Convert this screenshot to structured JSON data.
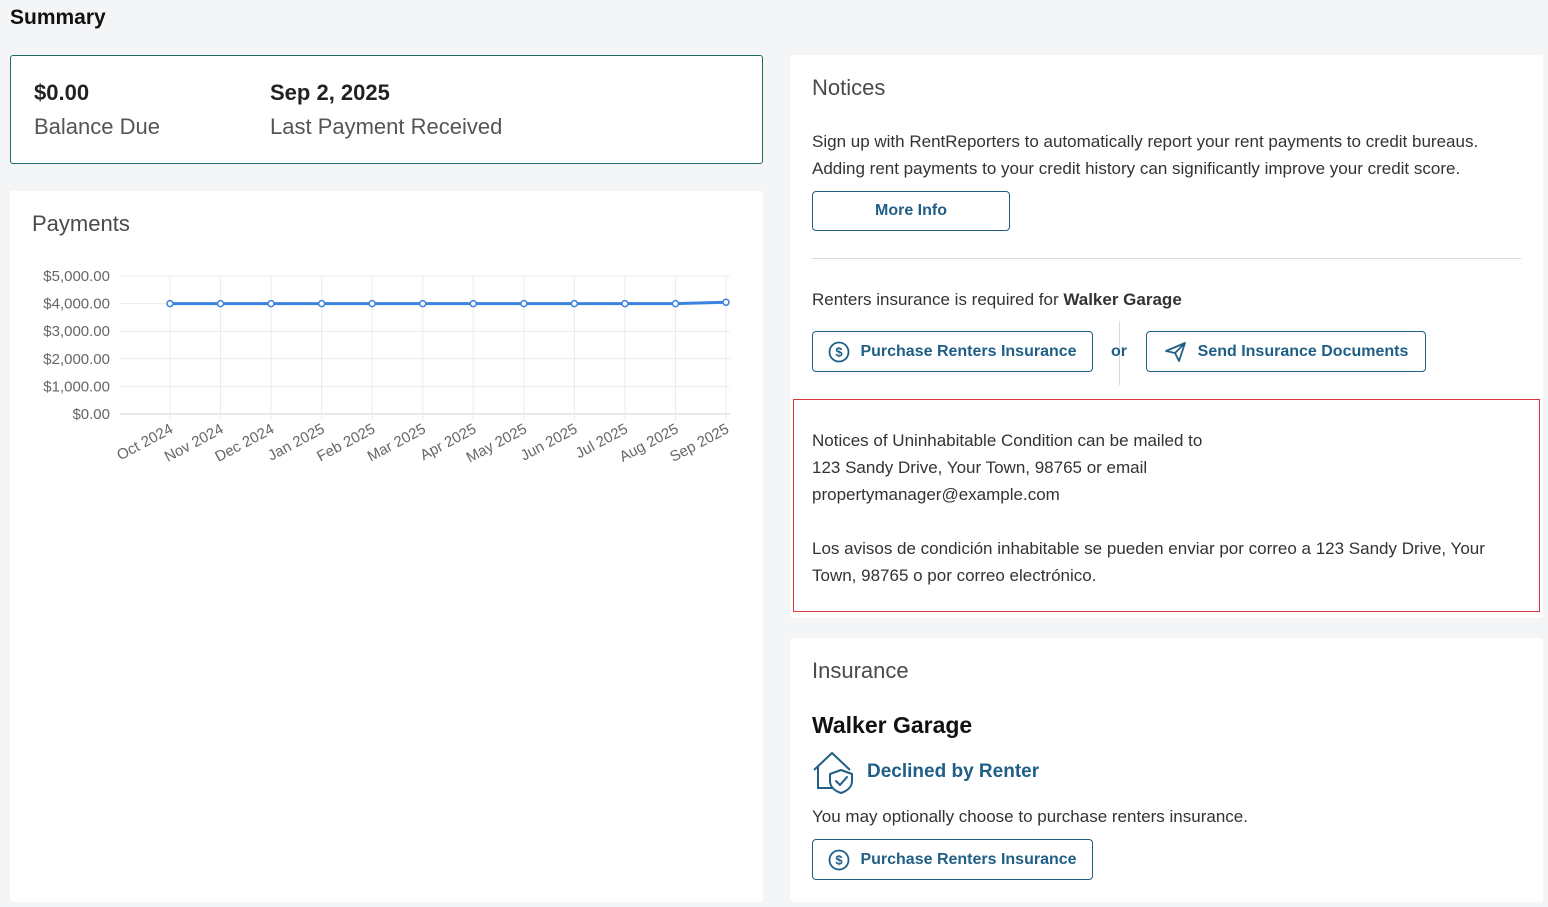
{
  "page": {
    "title": "Summary"
  },
  "summary": {
    "balance_value": "$0.00",
    "balance_label": "Balance Due",
    "last_payment_value": "Sep 2, 2025",
    "last_payment_label": "Last Payment Received"
  },
  "payments": {
    "heading": "Payments"
  },
  "chart_data": {
    "type": "line",
    "categories": [
      "Oct 2024",
      "Nov 2024",
      "Dec 2024",
      "Jan 2025",
      "Feb 2025",
      "Mar 2025",
      "Apr 2025",
      "May 2025",
      "Jun 2025",
      "Jul 2025",
      "Aug 2025",
      "Sep 2025"
    ],
    "values": [
      4000,
      4000,
      4000,
      4000,
      4000,
      4000,
      4000,
      4000,
      4000,
      4000,
      4000,
      4050
    ],
    "y_ticks": [
      "$0.00",
      "$1,000.00",
      "$2,000.00",
      "$3,000.00",
      "$4,000.00",
      "$5,000.00"
    ],
    "ylim": [
      0,
      5000
    ],
    "title": "",
    "xlabel": "",
    "ylabel": "",
    "grid": true,
    "line_color": "#3b82e0"
  },
  "notices": {
    "heading": "Notices",
    "rentreporters_line1": "Sign up with RentReporters to automatically report your rent payments to credit bureaus.",
    "rentreporters_line2": "Adding rent payments to your credit history can significantly improve your credit score.",
    "more_info_label": "More Info",
    "insurance_required_prefix": "Renters insurance is required for ",
    "insurance_required_property": "Walker Garage",
    "purchase_label": "Purchase Renters Insurance",
    "or_label": "or",
    "send_docs_label": "Send Insurance Documents",
    "uninhabitable_en_line1": "Notices of Uninhabitable Condition can be mailed to",
    "uninhabitable_en_line2": "123 Sandy Drive, Your Town, 98765 or email",
    "uninhabitable_en_line3": "propertymanager@example.com",
    "uninhabitable_es_line1": "Los avisos de condición inhabitable se pueden enviar por correo a 123 Sandy Drive, Your",
    "uninhabitable_es_line2": "Town, 98765 o por correo electrónico."
  },
  "insurance": {
    "heading": "Insurance",
    "property_name": "Walker Garage",
    "status": "Declined by Renter",
    "note": "You may optionally choose to purchase renters insurance.",
    "purchase_label": "Purchase Renters Insurance"
  },
  "colors": {
    "accent": "#1f5f86",
    "summary_border": "#1f6b63",
    "alert_border": "#d9363e"
  },
  "icons": {
    "purchase": "dollar-circle-icon",
    "send": "paper-plane-icon",
    "status": "house-shield-icon"
  }
}
